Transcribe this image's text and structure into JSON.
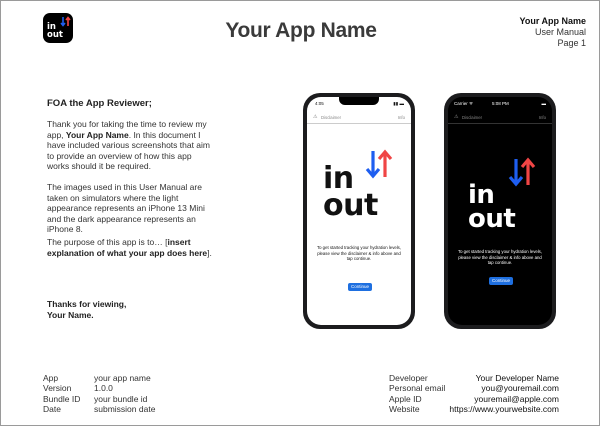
{
  "logo": {
    "line1": "in",
    "line2": "out",
    "arrow_blue": "#1e5ef0",
    "arrow_red": "#f04545"
  },
  "header": {
    "title": "Your App Name",
    "right_name": "Your App Name",
    "right_doc": "User Manual",
    "right_page": "Page 1"
  },
  "body": {
    "heading": "FOA the App Reviewer;",
    "p1_a": "Thank you for taking the time to review my app, ",
    "p1_bold": "Your App Name",
    "p1_b": ". In this document I have included various screenshots that aim to provide an overview of how this app works should it be required.",
    "p2": "The images used in this User Manual are taken on simulators where the light appearance represents an iPhone 13 Mini and the dark appearance represents an iPhone 8.",
    "p3_a": "The purpose of this app is to… [",
    "p3_bold": "insert explanation of what your app does here",
    "p3_b": "].",
    "thanks1": "Thanks for viewing,",
    "thanks2": "Your Name."
  },
  "phone_light": {
    "time": "4:05",
    "nav_left": "Disclaimer",
    "nav_right": "Info",
    "word1": "in",
    "word2": "out",
    "message": "To get started tracking your hydration levels, please view the disclaimer & info above and tap continue.",
    "button": "Continue"
  },
  "phone_dark": {
    "carrier": "Carrier ᯤ",
    "time": "5:08 PM",
    "nav_left": "Disclaimer",
    "nav_right": "Info",
    "word1": "in",
    "word2": "out",
    "message": "To get started tracking your hydration levels, please view the disclaimer & info above and tap continue.",
    "button": "Continue"
  },
  "footer_left": [
    {
      "key": "App",
      "value": "your app name"
    },
    {
      "key": "Version",
      "value": "1.0.0"
    },
    {
      "key": "Bundle ID",
      "value": "your bundle id"
    },
    {
      "key": "Date",
      "value": "submission date"
    }
  ],
  "footer_right": [
    {
      "key": "Developer",
      "value": "Your Developer Name"
    },
    {
      "key": "Personal email",
      "value": "you@youremail.com"
    },
    {
      "key": "Apple ID",
      "value": "youremail@apple.com"
    },
    {
      "key": "Website",
      "value": "https://www.yourwebsite.com"
    }
  ]
}
